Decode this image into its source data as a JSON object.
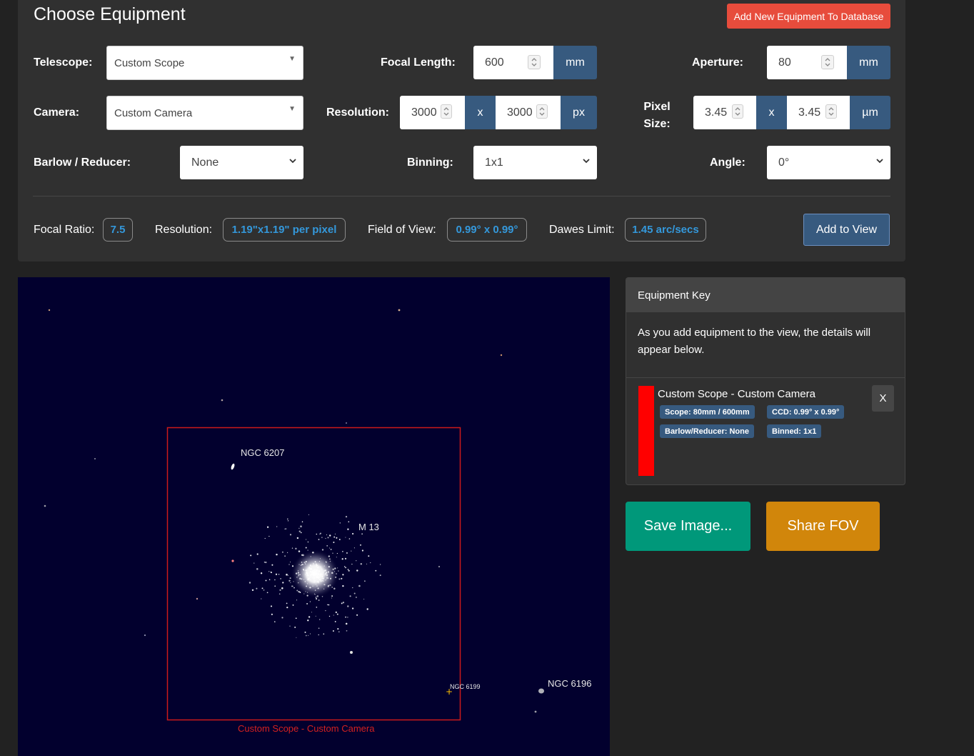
{
  "header": {
    "title": "Choose Equipment",
    "add_db_label": "Add New Equipment To Database"
  },
  "form": {
    "telescope": {
      "label": "Telescope:",
      "value": "Custom Scope"
    },
    "camera": {
      "label": "Camera:",
      "value": "Custom Camera"
    },
    "barlow": {
      "label": "Barlow / Reducer:",
      "value": "None"
    },
    "focal_length": {
      "label": "Focal Length:",
      "value": "600",
      "unit": "mm"
    },
    "resolution": {
      "label": "Resolution:",
      "width": "3000",
      "sep": "x",
      "height": "3000",
      "unit": "px"
    },
    "binning": {
      "label": "Binning:",
      "value": "1x1"
    },
    "aperture": {
      "label": "Aperture:",
      "value": "80",
      "unit": "mm"
    },
    "pixel_size": {
      "label_line1": "Pixel",
      "label_line2": "Size:",
      "width": "3.45",
      "sep": "x",
      "height": "3.45",
      "unit": "µm"
    },
    "angle": {
      "label": "Angle:",
      "value": "0°"
    }
  },
  "stats": {
    "focal_ratio": {
      "label": "Focal Ratio:",
      "value": "7.5"
    },
    "resolution": {
      "label": "Resolution:",
      "value": "1.19\"x1.19\" per pixel"
    },
    "fov": {
      "label": "Field of View:",
      "value": "0.99° x 0.99°"
    },
    "dawes": {
      "label": "Dawes Limit:",
      "value": "1.45 arc/secs"
    },
    "add_view_label": "Add to View"
  },
  "sky": {
    "background": "#02002e",
    "fov_color": "#cc1a1a",
    "fov_label": "Custom Scope - Custom Camera",
    "objects": {
      "ngc6207": "NGC 6207",
      "m13": "M 13",
      "ngc6199": "NGC 6199",
      "ngc6196": "NGC 6196"
    }
  },
  "key": {
    "title": "Equipment Key",
    "description": "As you add equipment to the view, the details will appear below.",
    "entry": {
      "title": "Custom Scope - Custom Camera",
      "color": "#ff0000",
      "tags": {
        "scope": "Scope: 80mm / 600mm",
        "ccd": "CCD: 0.99° x 0.99°",
        "barlow": "Barlow/Reducer: None",
        "binned": "Binned: 1x1"
      },
      "remove_label": "X"
    }
  },
  "actions": {
    "save_label": "Save Image...",
    "share_label": "Share FOV"
  },
  "colors": {
    "primary": "#375a7f",
    "danger": "#e74c3c",
    "success": "#00987a",
    "warning": "#d1860b",
    "info_text": "#3498db"
  }
}
